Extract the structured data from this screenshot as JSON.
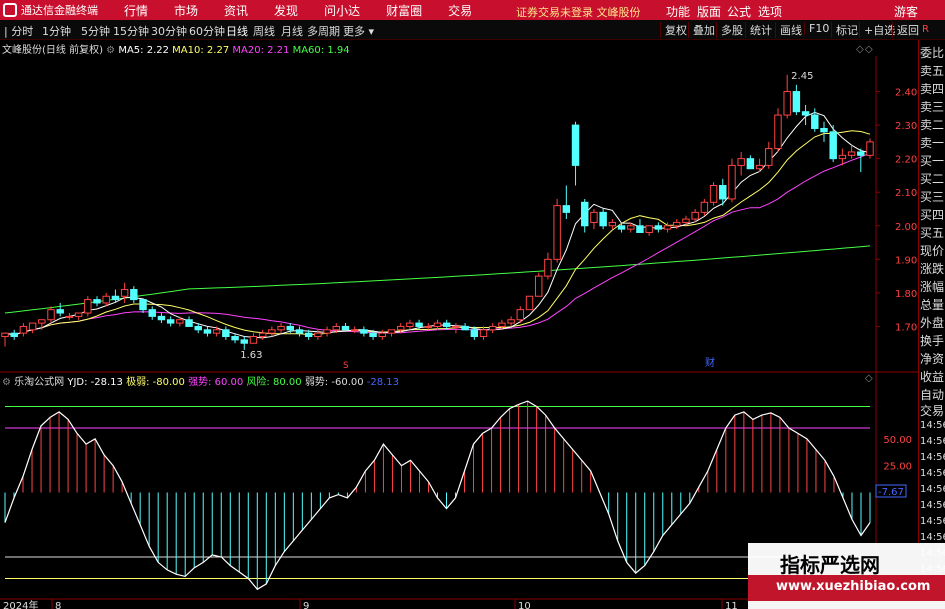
{
  "titlebar": {
    "app_name": "通达信金融终端",
    "menus": [
      "行情",
      "市场",
      "资讯",
      "发现",
      "问小达",
      "财富圈",
      "交易"
    ],
    "warning": "证券交易未登录",
    "stock_link": "文峰股份",
    "right_menus": [
      "功能",
      "版面",
      "公式",
      "选项"
    ],
    "guest": "游客"
  },
  "toolbar": {
    "periods": [
      "分时",
      "1分钟",
      "5分钟",
      "15分钟",
      "30分钟",
      "60分钟",
      "日线",
      "周线",
      "月线",
      "多周期",
      "更多"
    ],
    "active_period": "日线",
    "right_buttons": [
      "复权",
      "叠加",
      "多股",
      "统计",
      "画线",
      "F10",
      "标记",
      "+自选",
      "返回"
    ],
    "r_badge": "R"
  },
  "main_info": {
    "title": "文峰股份(日线 前复权)",
    "ma5": "MA5: 2.22",
    "ma10": "MA10: 2.27",
    "ma20": "MA20: 2.21",
    "ma60": "MA60: 1.94",
    "colors": {
      "ma5": "#ffffff",
      "ma10": "#ffff66",
      "ma20": "#ff44ff",
      "ma60": "#44ff44",
      "up": "#ff4444",
      "down": "#54ffff"
    }
  },
  "price_axis": [
    "2.40",
    "2.30",
    "2.20",
    "2.10",
    "2.00",
    "1.90",
    "1.80",
    "1.70"
  ],
  "annotations": {
    "high": "2.45",
    "low": "1.63",
    "event": "财",
    "marker": "S"
  },
  "indicator_info": {
    "name": "乐淘公式网",
    "yjd": "YJD: -28.13",
    "jiruo": "极弱: -80.00",
    "qiangshi": "强势: 60.00",
    "fengxian": "风险: 80.00",
    "ruoshi": "弱势: -60.00",
    "last": "-28.13"
  },
  "indicator_axis": [
    "50.00",
    "25.00"
  ],
  "indicator_value_box": "-7.67",
  "date_axis": {
    "year": "2024年",
    "months": [
      "8",
      "9",
      "10",
      "11"
    ]
  },
  "sidebar": {
    "items": [
      "委比",
      "卖五",
      "卖四",
      "卖三",
      "卖二",
      "卖一",
      "买一",
      "买二",
      "买三",
      "买四",
      "买五",
      "现价",
      "涨跌",
      "涨幅",
      "总量",
      "外盘",
      "换手",
      "净资",
      "收益"
    ],
    "lower": [
      "自动",
      "交易"
    ],
    "times": [
      "14:56",
      "14:56",
      "14:56",
      "14:56",
      "14:56",
      "14:56",
      "14:56",
      "14:56",
      "14:56",
      "14:56"
    ]
  },
  "watermark": {
    "title": "指标严选网",
    "url": "www.xuezhibiao.com"
  },
  "chart_data": {
    "type": "candlestick",
    "price_range": [
      1.6,
      2.5
    ],
    "candles": [
      [
        1.67,
        1.68,
        1.64,
        1.68
      ],
      [
        1.68,
        1.69,
        1.66,
        1.67
      ],
      [
        1.68,
        1.71,
        1.67,
        1.7
      ],
      [
        1.69,
        1.71,
        1.68,
        1.71
      ],
      [
        1.71,
        1.72,
        1.69,
        1.72
      ],
      [
        1.72,
        1.76,
        1.71,
        1.75
      ],
      [
        1.75,
        1.77,
        1.73,
        1.74
      ],
      [
        1.73,
        1.74,
        1.72,
        1.73
      ],
      [
        1.73,
        1.74,
        1.72,
        1.74
      ],
      [
        1.74,
        1.79,
        1.73,
        1.78
      ],
      [
        1.78,
        1.79,
        1.76,
        1.77
      ],
      [
        1.77,
        1.8,
        1.76,
        1.79
      ],
      [
        1.79,
        1.81,
        1.77,
        1.78
      ],
      [
        1.79,
        1.83,
        1.77,
        1.81
      ],
      [
        1.81,
        1.82,
        1.77,
        1.78
      ],
      [
        1.78,
        1.78,
        1.74,
        1.75
      ],
      [
        1.75,
        1.76,
        1.72,
        1.73
      ],
      [
        1.73,
        1.74,
        1.71,
        1.72
      ],
      [
        1.72,
        1.73,
        1.7,
        1.71
      ],
      [
        1.71,
        1.73,
        1.7,
        1.72
      ],
      [
        1.72,
        1.73,
        1.7,
        1.7
      ],
      [
        1.7,
        1.71,
        1.68,
        1.69
      ],
      [
        1.69,
        1.7,
        1.67,
        1.68
      ],
      [
        1.68,
        1.7,
        1.67,
        1.69
      ],
      [
        1.69,
        1.7,
        1.66,
        1.67
      ],
      [
        1.67,
        1.68,
        1.65,
        1.66
      ],
      [
        1.66,
        1.67,
        1.63,
        1.65
      ],
      [
        1.65,
        1.68,
        1.65,
        1.67
      ],
      [
        1.67,
        1.69,
        1.66,
        1.68
      ],
      [
        1.68,
        1.7,
        1.67,
        1.69
      ],
      [
        1.69,
        1.71,
        1.68,
        1.7
      ],
      [
        1.7,
        1.71,
        1.68,
        1.69
      ],
      [
        1.69,
        1.7,
        1.67,
        1.68
      ],
      [
        1.68,
        1.69,
        1.66,
        1.67
      ],
      [
        1.67,
        1.69,
        1.66,
        1.68
      ],
      [
        1.68,
        1.7,
        1.67,
        1.69
      ],
      [
        1.69,
        1.71,
        1.68,
        1.7
      ],
      [
        1.7,
        1.71,
        1.69,
        1.69
      ],
      [
        1.69,
        1.7,
        1.68,
        1.69
      ],
      [
        1.69,
        1.7,
        1.67,
        1.68
      ],
      [
        1.68,
        1.69,
        1.66,
        1.67
      ],
      [
        1.67,
        1.69,
        1.66,
        1.68
      ],
      [
        1.68,
        1.69,
        1.67,
        1.69
      ],
      [
        1.69,
        1.71,
        1.68,
        1.7
      ],
      [
        1.7,
        1.72,
        1.69,
        1.71
      ],
      [
        1.71,
        1.72,
        1.69,
        1.7
      ],
      [
        1.7,
        1.71,
        1.69,
        1.7
      ],
      [
        1.7,
        1.72,
        1.69,
        1.71
      ],
      [
        1.71,
        1.72,
        1.69,
        1.7
      ],
      [
        1.7,
        1.71,
        1.68,
        1.7
      ],
      [
        1.7,
        1.71,
        1.69,
        1.69
      ],
      [
        1.69,
        1.7,
        1.66,
        1.67
      ],
      [
        1.67,
        1.7,
        1.66,
        1.69
      ],
      [
        1.69,
        1.71,
        1.68,
        1.7
      ],
      [
        1.7,
        1.72,
        1.69,
        1.71
      ],
      [
        1.71,
        1.73,
        1.7,
        1.72
      ],
      [
        1.72,
        1.76,
        1.71,
        1.75
      ],
      [
        1.75,
        1.79,
        1.75,
        1.79
      ],
      [
        1.79,
        1.86,
        1.79,
        1.85
      ],
      [
        1.85,
        1.92,
        1.84,
        1.9
      ],
      [
        1.9,
        2.08,
        1.89,
        2.06
      ],
      [
        2.06,
        2.12,
        2.02,
        2.04
      ],
      [
        2.3,
        2.31,
        2.12,
        2.18
      ],
      [
        2.07,
        2.08,
        1.98,
        2.0
      ],
      [
        2.01,
        2.05,
        1.99,
        2.04
      ],
      [
        2.04,
        2.05,
        1.99,
        2.0
      ],
      [
        2.0,
        2.02,
        1.99,
        2.01
      ],
      [
        2.0,
        2.01,
        1.98,
        1.99
      ],
      [
        1.99,
        2.01,
        1.98,
        2.0
      ],
      [
        2.0,
        2.02,
        1.98,
        1.98
      ],
      [
        1.98,
        2.0,
        1.97,
        2.0
      ],
      [
        2.0,
        2.01,
        1.98,
        1.99
      ],
      [
        1.99,
        2.01,
        1.98,
        2.0
      ],
      [
        2.0,
        2.02,
        1.99,
        2.01
      ],
      [
        2.01,
        2.03,
        2.0,
        2.02
      ],
      [
        2.02,
        2.05,
        2.01,
        2.04
      ],
      [
        2.04,
        2.08,
        2.03,
        2.07
      ],
      [
        2.07,
        2.13,
        2.06,
        2.12
      ],
      [
        2.12,
        2.14,
        2.06,
        2.08
      ],
      [
        2.08,
        2.2,
        2.07,
        2.18
      ],
      [
        2.18,
        2.22,
        2.15,
        2.2
      ],
      [
        2.2,
        2.21,
        2.17,
        2.17
      ],
      [
        2.17,
        2.2,
        2.16,
        2.18
      ],
      [
        2.18,
        2.25,
        2.17,
        2.23
      ],
      [
        2.23,
        2.35,
        2.22,
        2.33
      ],
      [
        2.33,
        2.45,
        2.32,
        2.4
      ],
      [
        2.4,
        2.42,
        2.33,
        2.34
      ],
      [
        2.34,
        2.36,
        2.3,
        2.33
      ],
      [
        2.33,
        2.35,
        2.28,
        2.29
      ],
      [
        2.29,
        2.31,
        2.25,
        2.28
      ],
      [
        2.28,
        2.3,
        2.19,
        2.2
      ],
      [
        2.2,
        2.23,
        2.18,
        2.21
      ],
      [
        2.21,
        2.24,
        2.2,
        2.22
      ],
      [
        2.22,
        2.23,
        2.16,
        2.21
      ],
      [
        2.21,
        2.26,
        2.2,
        2.25
      ]
    ],
    "ma60_range": [
      1.8,
      1.94
    ],
    "indicator_range": [
      -100,
      100
    ],
    "indicator_levels": {
      "fengxian": 80,
      "qiangshi": 60,
      "ruoshi": -60,
      "jiruo": -80
    },
    "indicator_values": [
      -28,
      -5,
      15,
      40,
      62,
      70,
      75,
      68,
      55,
      45,
      50,
      35,
      25,
      10,
      -10,
      -30,
      -50,
      -65,
      -72,
      -76,
      -78,
      -70,
      -65,
      -58,
      -60,
      -68,
      -74,
      -80,
      -90,
      -85,
      -68,
      -55,
      -45,
      -35,
      -25,
      -15,
      -5,
      -2,
      -5,
      5,
      20,
      30,
      45,
      35,
      25,
      30,
      20,
      10,
      -5,
      -15,
      -5,
      20,
      45,
      55,
      60,
      70,
      78,
      82,
      85,
      80,
      72,
      60,
      50,
      40,
      30,
      20,
      0,
      -20,
      -45,
      -65,
      -75,
      -68,
      -55,
      -40,
      -30,
      -20,
      -10,
      5,
      20,
      40,
      60,
      72,
      75,
      68,
      72,
      74,
      70,
      60,
      55,
      50,
      40,
      30,
      15,
      -5,
      -25,
      -40,
      -28
    ]
  }
}
